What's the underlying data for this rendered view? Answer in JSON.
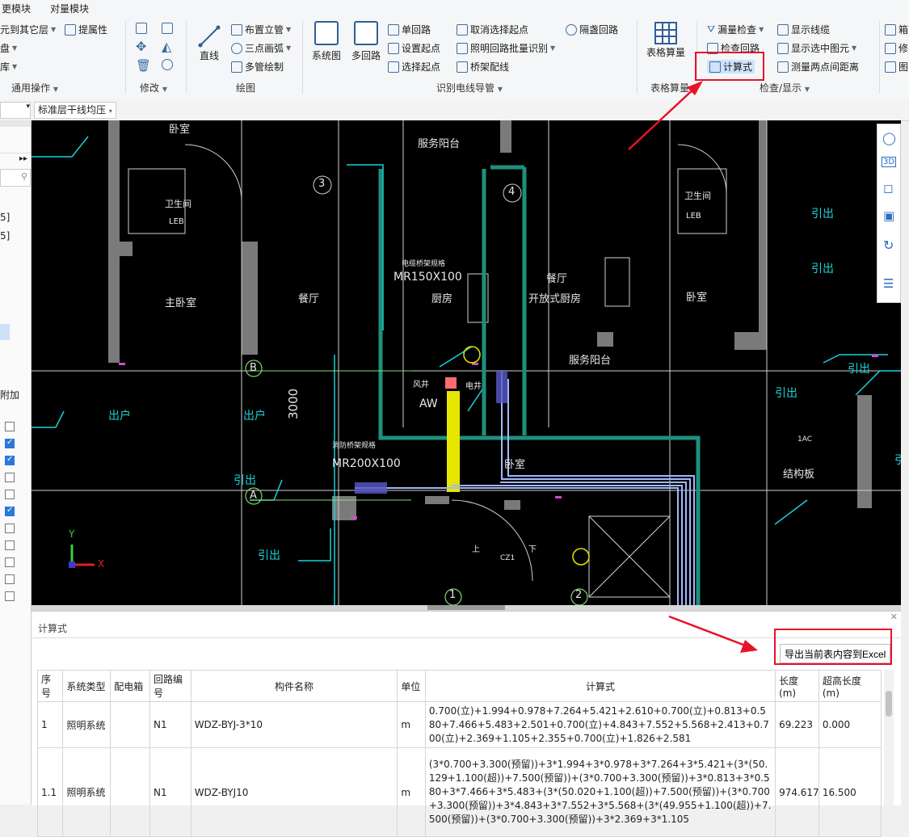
{
  "ribbon": {
    "tabs": [
      "更模块",
      "对量模块"
    ],
    "general_ops": {
      "items": [
        "元到其它层",
        "提属性",
        "盘",
        "库"
      ],
      "label": "通用操作"
    },
    "modify_label": "修改",
    "draw": {
      "line": "直线",
      "buttons": [
        "布置立管",
        "三点画弧",
        "多管绘制"
      ],
      "label": "绘图"
    },
    "identify": {
      "system_diagram": "系统图",
      "multi_circuit": "多回路",
      "col1": [
        "单回路",
        "设置起点",
        "选择起点"
      ],
      "col2": [
        "取消选择起点",
        "照明回路批量识别",
        "桥架配线"
      ],
      "col3": [
        "隔盏回路"
      ],
      "label": "识别电线导管"
    },
    "table_calc": {
      "button": "表格算量",
      "label": "表格算量"
    },
    "check": {
      "col1": [
        "漏量检查",
        "检查回路",
        "计算式"
      ],
      "col2": [
        "显示线缆",
        "显示选中图元",
        "测量两点间距离"
      ],
      "label": "检查/显示"
    },
    "right_cut": [
      "箱",
      "修",
      "图"
    ]
  },
  "subbar": {
    "layer_select": "标准层干线均压"
  },
  "canvas": {
    "rooms": [
      "卧室",
      "服务阳台",
      "卫生间",
      "主卧室",
      "餐厅",
      "厨房",
      "餐厅",
      "开放式厨房",
      "卧室",
      "服务阳台",
      "卫生间",
      "结构板",
      "引出",
      "引出",
      "引出",
      "出户",
      "出户",
      "引出",
      "引出",
      "引出",
      "引出"
    ],
    "labels": {
      "tray1_title": "电缆桥架规格",
      "tray1": "MR150X100",
      "tray2_title": "消防桥架规格",
      "tray2": "MR200X100",
      "dim": "3000",
      "aw": "AW",
      "axis_b": "B",
      "axis_a": "A",
      "axis_1": "1",
      "axis_2": "2",
      "axis_3": "3",
      "axis_4": "4",
      "leb1": "LEB",
      "leb2": "LEB",
      "ac": "1AC",
      "stair_up": "上",
      "stair_down": "下",
      "cz": "CZ1",
      "fan": "风井",
      "elec": "电井",
      "room_b": "卧室"
    },
    "axis_x": "X",
    "axis_y": "Y"
  },
  "left_panel": {
    "vals": [
      "5]",
      "5]"
    ],
    "add_label": "附加",
    "checkboxes": [
      false,
      true,
      true,
      false,
      false,
      true,
      false,
      false,
      false,
      false,
      false
    ]
  },
  "calc_panel": {
    "title": "计算式",
    "export_button": "导出当前表内容到Excel",
    "columns": [
      "序号",
      "系统类型",
      "配电箱",
      "回路编号",
      "构件名称",
      "单位",
      "计算式",
      "长度(m)",
      "超高长度(m)"
    ],
    "rows": [
      {
        "no": "1",
        "system": "照明系统",
        "box": "",
        "circuit": "N1",
        "name": "WDZ-BYJ-3*10",
        "unit": "m",
        "formula": "0.700(立)+1.994+0.978+7.264+5.421+2.610+0.700(立)+0.813+0.580+7.466+5.483+2.501+0.700(立)+4.843+7.552+5.568+2.413+0.700(立)+2.369+1.105+2.355+0.700(立)+1.826+2.581",
        "length": "69.223",
        "over": "0.000"
      },
      {
        "no": "1.1",
        "system": "照明系统",
        "box": "",
        "circuit": "N1",
        "name": "WDZ-BYJ10",
        "unit": "m",
        "formula": "(3*0.700+3.300(预留))+3*1.994+3*0.978+3*7.264+3*5.421+(3*(50.129+1.100(超))+7.500(预留))+(3*0.700+3.300(预留))+3*0.813+3*0.580+3*7.466+3*5.483+(3*(50.020+1.100(超))+7.500(预留))+(3*0.700+3.300(预留))+3*4.843+3*7.552+3*5.568+(3*(49.955+1.100(超))+7.500(预留))+(3*0.700+3.300(预留))+3*2.369+3*1.105",
        "length": "974.617",
        "over": "16.500"
      }
    ]
  },
  "colors": {
    "accent": "#2a79d7",
    "highlight": "#e8132a",
    "cad_bg": "#000000",
    "cad_cyan": "#19d3d8",
    "cad_green": "#1f8f7c",
    "cad_yellow": "#e6e600",
    "cad_blue": "#a3b8ff"
  }
}
